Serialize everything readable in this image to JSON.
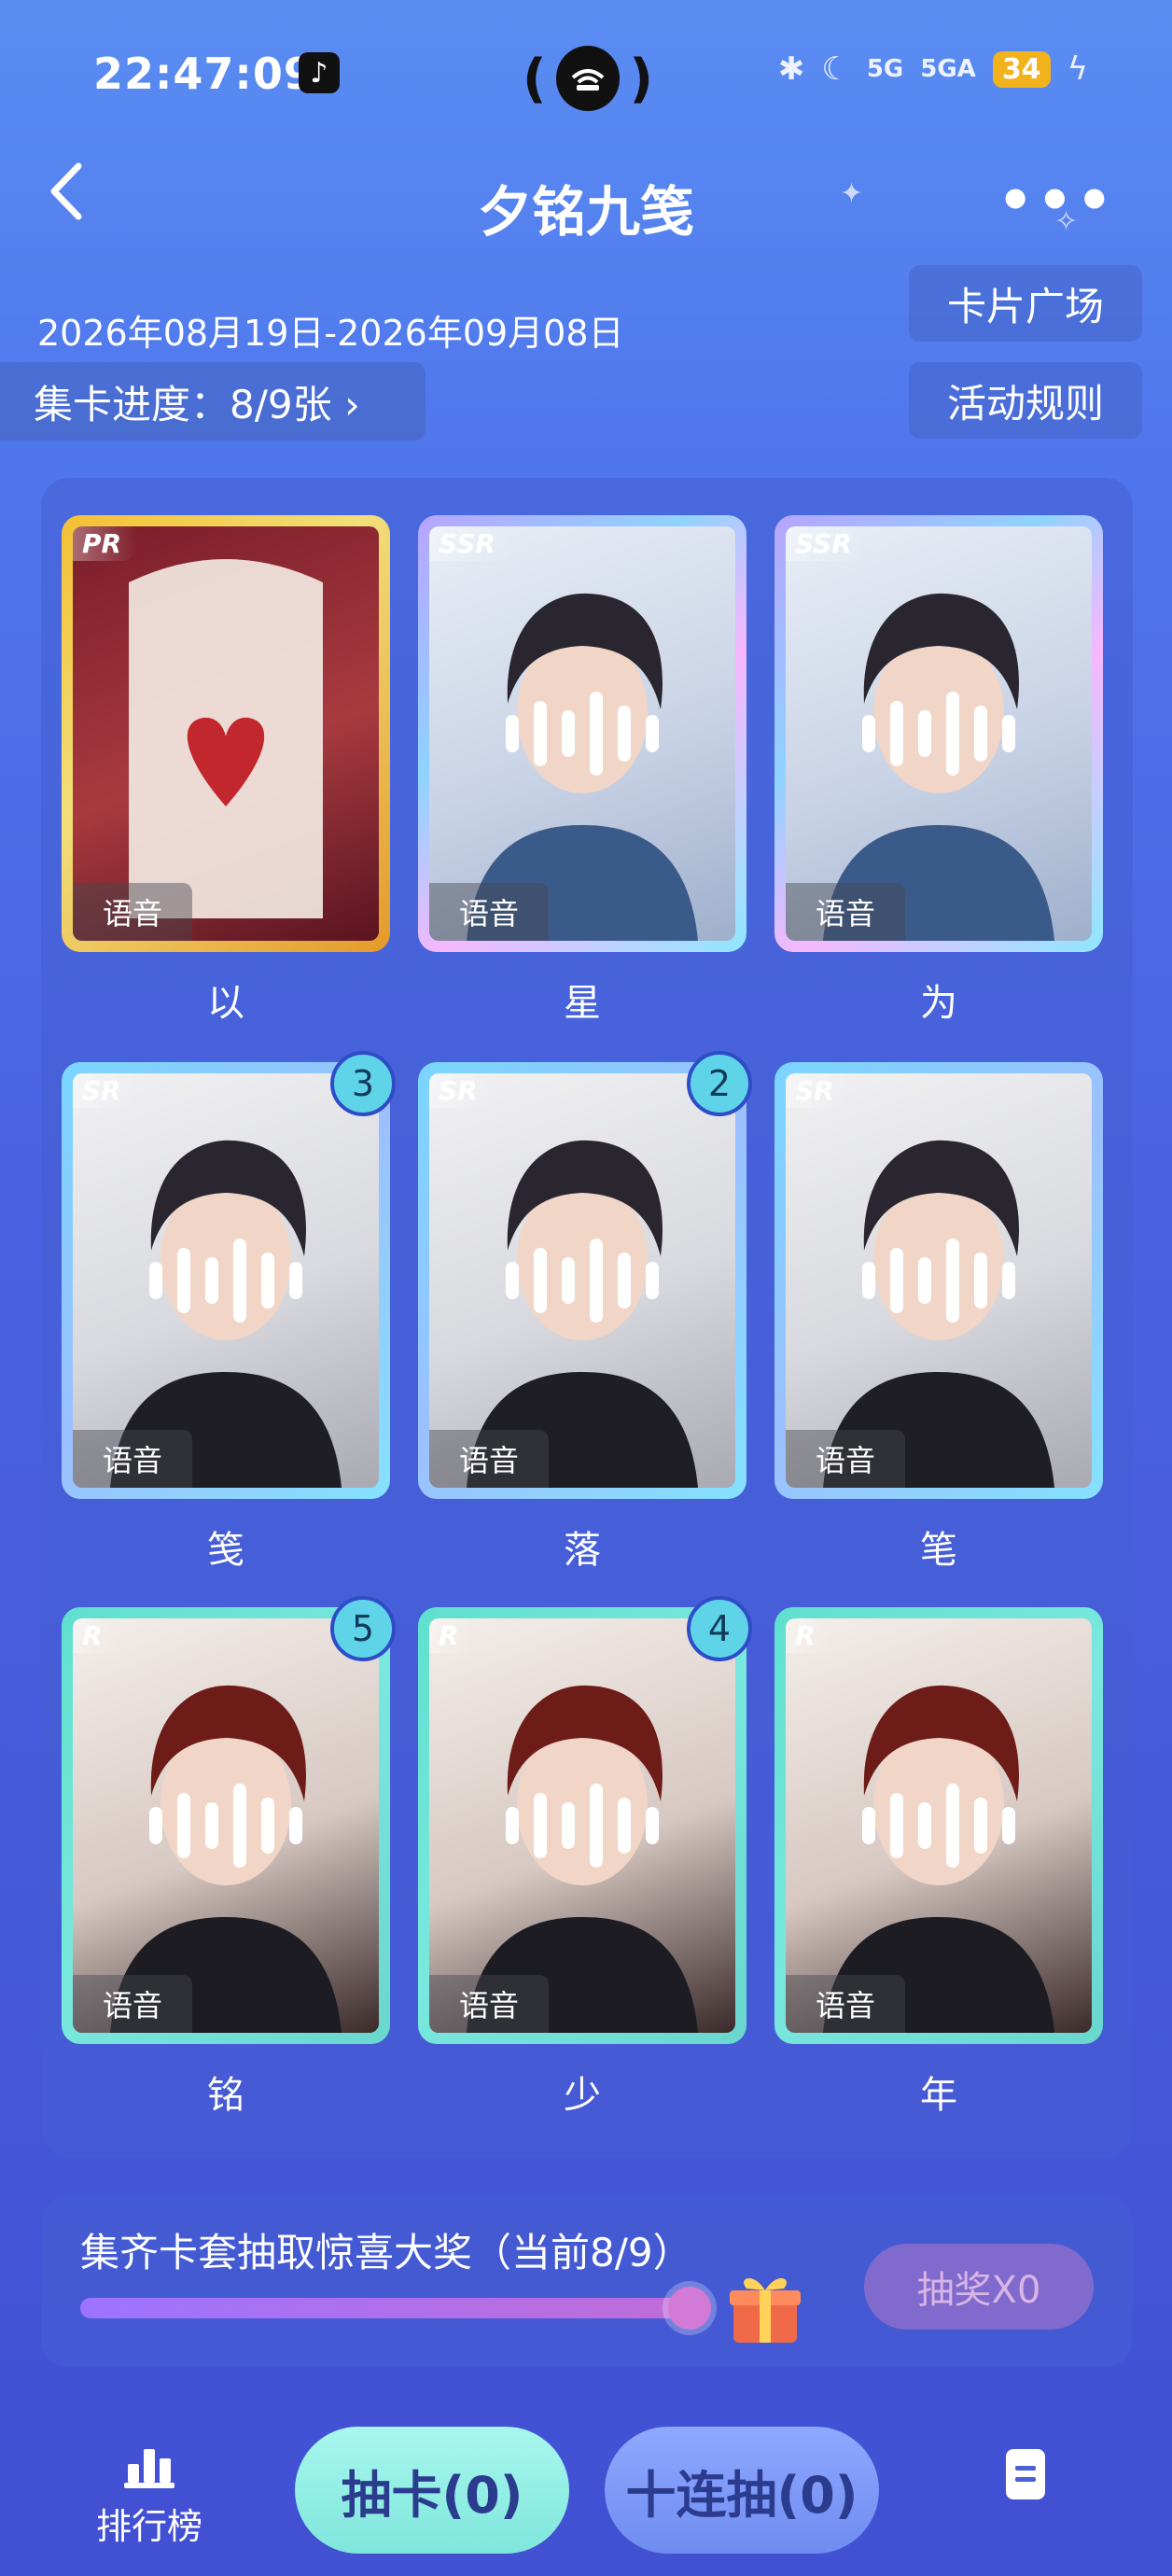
{
  "status_bar": {
    "time": "22:47:09",
    "network1": "5G",
    "network2": "5GA",
    "battery": "34"
  },
  "header": {
    "title": "夕铭九笺",
    "back_icon": "chevron-left-icon",
    "more_icon": "more-dots-icon"
  },
  "info": {
    "date_range": "2026年08月19日-2026年09月08日",
    "progress": "集卡进度：8/9张 ›",
    "card_square": "卡片广场",
    "rules": "活动规则"
  },
  "cards": [
    {
      "rarity": "PR",
      "voice": "语音",
      "name": "以",
      "count": "",
      "frame": "pr"
    },
    {
      "rarity": "SSR",
      "voice": "语音",
      "name": "星",
      "count": "",
      "frame": "ssr"
    },
    {
      "rarity": "SSR",
      "voice": "语音",
      "name": "为",
      "count": "",
      "frame": "ssr"
    },
    {
      "rarity": "SR",
      "voice": "语音",
      "name": "笺",
      "count": "3",
      "frame": "sr"
    },
    {
      "rarity": "SR",
      "voice": "语音",
      "name": "落",
      "count": "2",
      "frame": "sr"
    },
    {
      "rarity": "SR",
      "voice": "语音",
      "name": "笔",
      "count": "",
      "frame": "sr"
    },
    {
      "rarity": "R",
      "voice": "语音",
      "name": "铭",
      "count": "5",
      "frame": "r"
    },
    {
      "rarity": "R",
      "voice": "语音",
      "name": "少",
      "count": "4",
      "frame": "r"
    },
    {
      "rarity": "R",
      "voice": "语音",
      "name": "年",
      "count": "",
      "frame": "r"
    }
  ],
  "prize": {
    "text": "集齐卡套抽取惊喜大奖（当前8/9）",
    "progress_fraction": 0.889,
    "draw_label": "抽奖X0"
  },
  "bottom": {
    "rank_label": "排行榜",
    "draw_card": "抽卡(0)",
    "ten_draw": "十连抽(0)"
  }
}
